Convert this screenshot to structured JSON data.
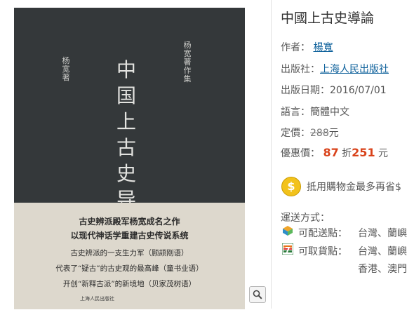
{
  "book": {
    "cover": {
      "author": "杨宽著",
      "title": "中国上古史导论",
      "series": "杨宽著作集",
      "blurb": [
        "古史辨派殿军杨宽成名之作",
        "以现代神话学重建古史传说系统",
        "古史辨派的一支生力军（顾颉刚语）",
        "代表了“疑古”的古史观的最高峰（童书业语）",
        "开创“新释古派”的新境地（贝家茂树语）"
      ],
      "publisher_mark": "上海人民出版社"
    }
  },
  "product": {
    "title": "中國上古史導論",
    "author_label": "作者：",
    "author": "楊寬",
    "publisher_label": "出版社：",
    "publisher": "上海人民出版社",
    "date_label": "出版日期：",
    "date": "2016/07/01",
    "language_label": "語言：",
    "language": "簡體中文",
    "list_price_label": "定價：",
    "list_price": "288",
    "currency": "元",
    "sale_label": "優惠價：",
    "discount": "87",
    "discount_unit": "折",
    "sale_price": "251",
    "credit_text": "抵用購物金最多再省$",
    "coin_glyph": "$",
    "shipping_label": "運送方式：",
    "ship_home_label": "可配送點：",
    "ship_home_places": "台灣、蘭嶼",
    "ship_store_label": "可取貨點：",
    "ship_store_places": "台灣、蘭嶼",
    "ship_store_places_2": "香港、澳門"
  },
  "colors": {
    "link": "#0b5f9a",
    "price": "#d9421a",
    "cover": "#34383a",
    "belly": "#ddd8cd"
  },
  "icons": {
    "zoom": "magnifier-icon",
    "coin": "coin-icon",
    "home_delivery": "box-icon",
    "store_pickup": "seven-eleven-icon"
  }
}
